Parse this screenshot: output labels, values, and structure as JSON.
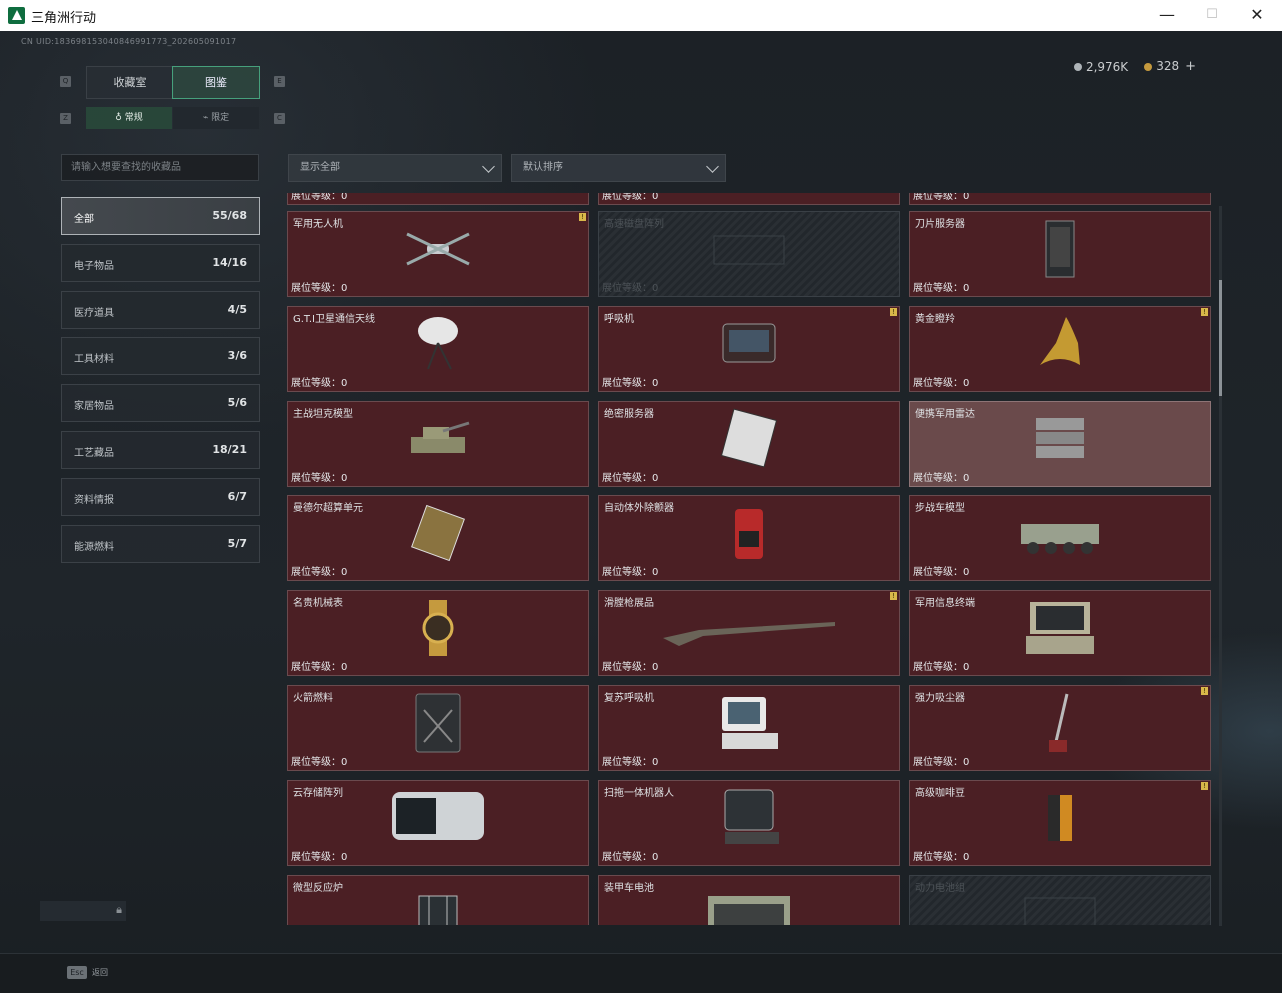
{
  "window": {
    "title": "三角洲行动",
    "min": "—",
    "max": "☐",
    "close": "✕"
  },
  "header": {
    "uid": "CN UID:183698153040846991773_202605091017",
    "currency_silver": "2,976K",
    "currency_gold": "328",
    "add": "+"
  },
  "keys": {
    "q": "Q",
    "e": "E",
    "z": "Z",
    "c": "C",
    "esc": "Esc"
  },
  "tabs": {
    "collection": "收藏室",
    "catalog": "图鉴"
  },
  "subtabs": {
    "normal": "常规",
    "limited": "限定"
  },
  "search": {
    "placeholder": "请输入想要查找的收藏品"
  },
  "filters": {
    "display": "显示全部",
    "sort": "默认排序"
  },
  "categories": [
    {
      "label": "全部",
      "count": "55/68"
    },
    {
      "label": "电子物品",
      "count": "14/16"
    },
    {
      "label": "医疗道具",
      "count": "4/5"
    },
    {
      "label": "工具材料",
      "count": "3/6"
    },
    {
      "label": "家居物品",
      "count": "5/6"
    },
    {
      "label": "工艺藏品",
      "count": "18/21"
    },
    {
      "label": "资料情报",
      "count": "6/7"
    },
    {
      "label": "能源燃料",
      "count": "5/7"
    }
  ],
  "level_prefix": "展位等级：0",
  "cards": [
    {
      "name": "军用无人机",
      "warn": "!",
      "icon": "drone-icon"
    },
    {
      "name": "高速磁盘阵列",
      "locked": true,
      "icon": "disk-array-icon"
    },
    {
      "name": "刀片服务器",
      "icon": "blade-server-icon"
    },
    {
      "name": "G.T.I卫星通信天线",
      "icon": "satellite-antenna-icon"
    },
    {
      "name": "呼吸机",
      "warn": "!",
      "icon": "ventilator-icon"
    },
    {
      "name": "黄金瞪羚",
      "warn": "!",
      "icon": "golden-gazelle-icon"
    },
    {
      "name": "主战坦克模型",
      "icon": "tank-model-icon"
    },
    {
      "name": "绝密服务器",
      "icon": "secret-server-icon"
    },
    {
      "name": "便携军用雷达",
      "highlight": true,
      "icon": "radar-icon"
    },
    {
      "name": "曼德尔超算单元",
      "icon": "supercomputer-icon"
    },
    {
      "name": "自动体外除颤器",
      "icon": "defibrillator-icon"
    },
    {
      "name": "步战车模型",
      "icon": "ifv-model-icon"
    },
    {
      "name": "名贵机械表",
      "icon": "watch-icon"
    },
    {
      "name": "滑膛枪展品",
      "warn": "!",
      "icon": "musket-icon"
    },
    {
      "name": "军用信息终端",
      "icon": "terminal-icon"
    },
    {
      "name": "火箭燃料",
      "icon": "fuel-can-icon"
    },
    {
      "name": "复苏呼吸机",
      "icon": "resuscitator-icon"
    },
    {
      "name": "强力吸尘器",
      "warn": "!",
      "icon": "vacuum-icon"
    },
    {
      "name": "云存储阵列",
      "icon": "cloud-storage-icon"
    },
    {
      "name": "扫拖一体机器人",
      "icon": "mop-robot-icon"
    },
    {
      "name": "高级咖啡豆",
      "warn": "!",
      "icon": "coffee-icon"
    },
    {
      "name": "微型反应炉",
      "icon": "reactor-icon"
    },
    {
      "name": "装甲车电池",
      "icon": "battery-icon"
    },
    {
      "name": "动力电池组",
      "locked": true,
      "icon": "power-battery-icon"
    }
  ],
  "footer": {
    "back": "返回"
  }
}
